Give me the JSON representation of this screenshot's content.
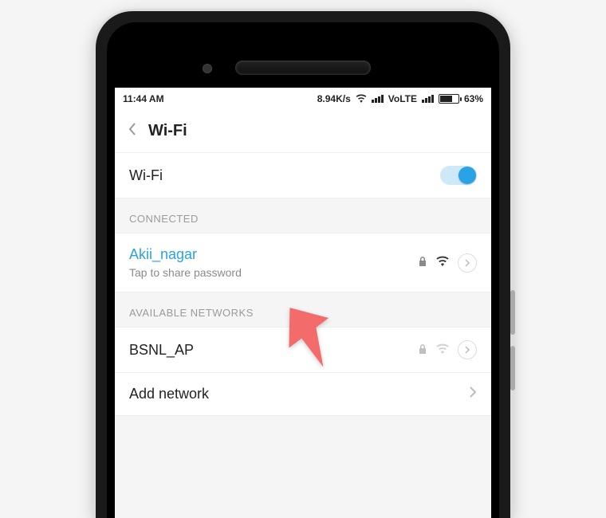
{
  "status": {
    "time": "11:44 AM",
    "speed": "8.94K/s",
    "volte": "VoLTE",
    "battery_pct": "63%"
  },
  "header": {
    "title": "Wi-Fi"
  },
  "wifi_toggle": {
    "label": "Wi-Fi",
    "on": true
  },
  "sections": {
    "connected_label": "CONNECTED",
    "available_label": "AVAILABLE NETWORKS"
  },
  "connected": {
    "ssid": "Akii_nagar",
    "hint": "Tap to share password"
  },
  "available": [
    {
      "ssid": "BSNL_AP"
    }
  ],
  "add_network_label": "Add network"
}
